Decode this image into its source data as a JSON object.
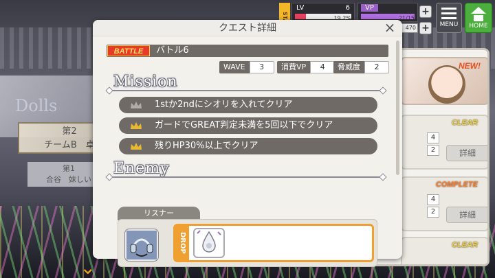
{
  "background": {
    "banner_line1": "第2",
    "banner_line2": "チームB　卓",
    "sub_banner_line1": "第1",
    "sub_banner_line2": "合谷　妹しい"
  },
  "hud": {
    "sta_label": "STA",
    "lv_label": "LV",
    "lv_value": "6",
    "lv_percent": "19.2%",
    "lv_progress": 0.192,
    "vp_label": "VP",
    "vp_value": "21/15",
    "vp_progress": 1.0,
    "coins": "470",
    "menu_label": "MENU",
    "home_label": "HOME"
  },
  "quest_list": {
    "new_badge": "NEW!",
    "cards": [
      {
        "status": "CLEAR",
        "numbers": [
          "4",
          "2"
        ],
        "detail_label": "詳細"
      },
      {
        "status": "COMPLETE",
        "numbers": [
          "4",
          "2"
        ],
        "detail_label": "詳細"
      },
      {
        "status": "CLEAR",
        "numbers": [],
        "detail_label": ""
      }
    ]
  },
  "modal": {
    "title": "クエスト詳細",
    "close_glyph": "×",
    "battle_tag": "BATTLE",
    "battle_name": "バトル6",
    "stats": [
      {
        "label": "WAVE",
        "value": "3"
      },
      {
        "label": "消費VP",
        "value": "4"
      },
      {
        "label": "脅威度",
        "value": "2"
      }
    ],
    "mission_heading": "Mission",
    "missions": [
      {
        "text": "1stか2ndにシオリを入れてクリア",
        "crown_color": "#b0aca8"
      },
      {
        "text": "ガードでGREAT判定未満を5回以下でクリア",
        "crown_color": "#e8b830"
      },
      {
        "text": "残りHP30%以上でクリア",
        "crown_color": "#e8b830"
      }
    ],
    "enemy_heading": "Enemy",
    "enemy_name": "リスナー",
    "drop_label": "DROP"
  },
  "icons": {
    "crown": "crown-icon",
    "enemy": "enemy-headphones-icon",
    "drop_item": "drop-crystal-icon",
    "menu": "menu-icon",
    "home": "home-icon",
    "close": "close-icon"
  }
}
